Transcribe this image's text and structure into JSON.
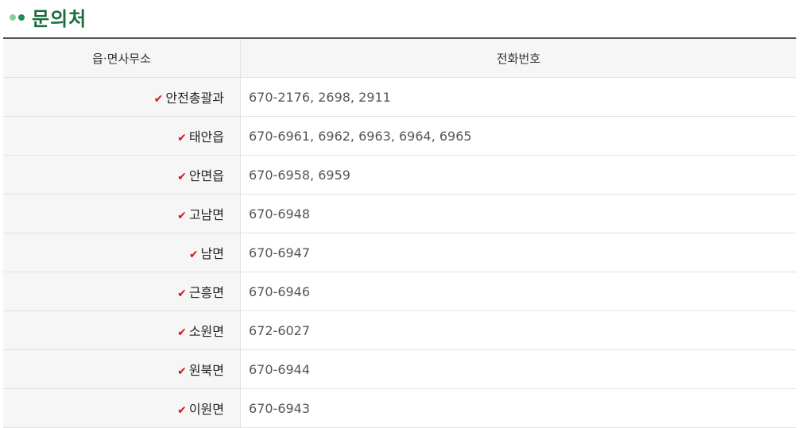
{
  "heading": {
    "title": "문의처",
    "bullet_icon": "double-dot-bullet-icon"
  },
  "table": {
    "headers": {
      "office": "읍·면사무소",
      "phone": "전화번호"
    },
    "rows": [
      {
        "office": "안전총괄과",
        "phone": "670-2176, 2698, 2911"
      },
      {
        "office": "태안읍",
        "phone": "670-6961, 6962, 6963, 6964, 6965"
      },
      {
        "office": "안면읍",
        "phone": "670-6958, 6959"
      },
      {
        "office": "고남면",
        "phone": "670-6948"
      },
      {
        "office": "남면",
        "phone": "670-6947"
      },
      {
        "office": "근흥면",
        "phone": "670-6946"
      },
      {
        "office": "소원면",
        "phone": "672-6027"
      },
      {
        "office": "원북면",
        "phone": "670-6944"
      },
      {
        "office": "이원면",
        "phone": "670-6943"
      }
    ],
    "check_icon": "checkmark-icon",
    "check_glyph": "✔"
  },
  "colors": {
    "heading_green": "#1b6b3f",
    "bullet_light": "#7fd3a1",
    "bullet_dark": "#1e8e4e",
    "check_red": "#d4141c",
    "header_border": "#555555"
  }
}
